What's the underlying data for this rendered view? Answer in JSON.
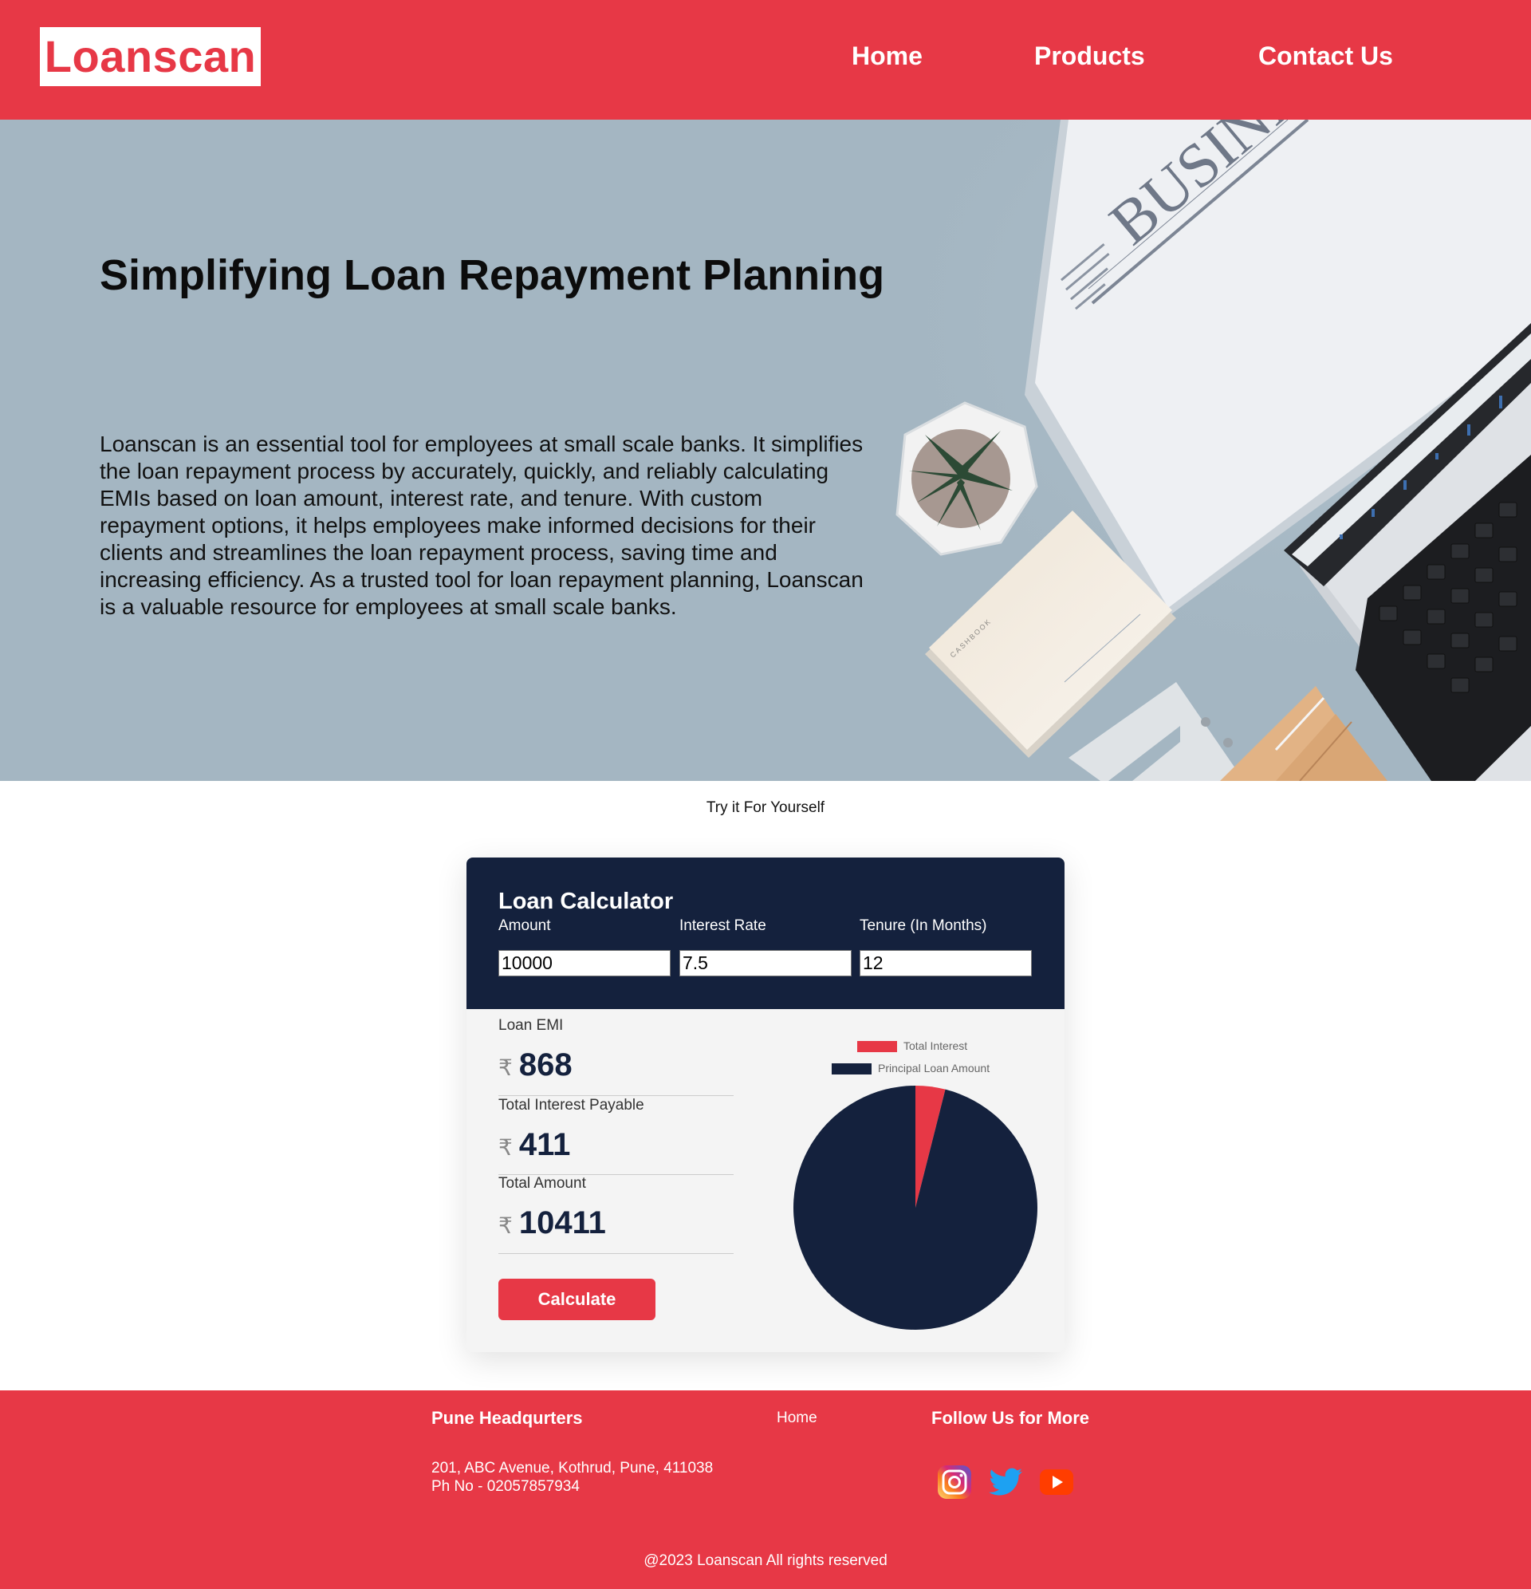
{
  "header": {
    "logo": "Loanscan",
    "nav": {
      "home": "Home",
      "products": "Products",
      "contact": "Contact Us"
    }
  },
  "hero": {
    "title": "Simplifying Loan Repayment Planning",
    "description": "Loanscan is an essential tool for employees at small scale banks. It simplifies the loan repayment process by accurately, quickly, and reliably calculating EMIs based on loan amount, interest rate, and tenure. With custom repayment options, it helps employees make informed decisions for their clients and streamlines the loan repayment process, saving time and increasing efficiency. As a trusted tool for loan repayment planning, Loanscan is a valuable resource for employees at small scale banks.",
    "image_text": {
      "newspaper": "BUSINE",
      "cashbook": "CASHBOOK"
    }
  },
  "try_label": "Try it For Yourself",
  "calculator": {
    "title": "Loan Calculator",
    "fields": {
      "amount_label": "Amount",
      "amount_value": "10000",
      "rate_label": "Interest Rate",
      "rate_value": "7.5",
      "tenure_label": "Tenure (In Months)",
      "tenure_value": "12"
    },
    "results": {
      "currency_symbol": "₹",
      "emi_label": "Loan EMI",
      "emi_value": "868",
      "interest_label": "Total Interest Payable",
      "interest_value": "411",
      "total_label": "Total Amount",
      "total_value": "10411"
    },
    "button_label": "Calculate",
    "legend": {
      "interest": "Total Interest",
      "principal": "Principal Loan Amount"
    }
  },
  "chart_data": {
    "type": "pie",
    "slices": [
      {
        "name": "Total Interest",
        "value": 411,
        "color": "#e73846"
      },
      {
        "name": "Principal Loan Amount",
        "value": 10000,
        "color": "#14213d"
      }
    ]
  },
  "footer": {
    "hq_title": "Pune Headqurters",
    "address": "201, ABC Avenue, Kothrud, Pune, 411038",
    "phone": "Ph No - 02057857934",
    "home_link": "Home",
    "follow_title": "Follow Us for More",
    "social": [
      "instagram-icon",
      "twitter-icon",
      "youtube-icon"
    ],
    "copyright": "@2023 Loanscan All rights reserved"
  },
  "colors": {
    "brand": "#e73846",
    "navy": "#14213d",
    "hero_bg": "#a4b6c2"
  }
}
